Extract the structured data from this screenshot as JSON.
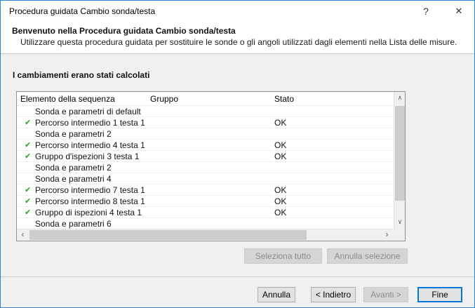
{
  "window": {
    "title": "Procedura guidata Cambio sonda/testa"
  },
  "icons": {
    "help_icon": "?",
    "close_icon": "✕",
    "scroll_up_icon": "∧",
    "scroll_down_icon": "∨",
    "scroll_left_icon": "‹",
    "scroll_right_icon": "›"
  },
  "header": {
    "title": "Benvenuto nella Procedura guidata Cambio sonda/testa",
    "subtitle": "Utilizzare questa procedura guidata per sostituire le sonde o gli angoli utilizzati dagli elementi nella Lista delle misure."
  },
  "content": {
    "section_label": "I cambiamenti erano stati calcolati",
    "table": {
      "columns": [
        "Elemento della sequenza",
        "Gruppo",
        "Stato"
      ],
      "rows": [
        {
          "check": "",
          "name": "Sonda e parametri di default",
          "group": "",
          "status": ""
        },
        {
          "check": "✔",
          "name": "Percorso intermedio 1 testa 1",
          "group": "",
          "status": "OK"
        },
        {
          "check": "",
          "name": "Sonda e parametri 2",
          "group": "",
          "status": ""
        },
        {
          "check": "✔",
          "name": "Percorso intermedio 4 testa 1",
          "group": "",
          "status": "OK"
        },
        {
          "check": "✔",
          "name": "Gruppo d'ispezioni 3 testa 1",
          "group": "",
          "status": "OK"
        },
        {
          "check": "",
          "name": "Sonda e parametri 2",
          "group": "",
          "status": ""
        },
        {
          "check": "",
          "name": "Sonda e parametri 4",
          "group": "",
          "status": ""
        },
        {
          "check": "✔",
          "name": "Percorso intermedio 7 testa 1",
          "group": "",
          "status": "OK"
        },
        {
          "check": "✔",
          "name": "Percorso intermedio 8 testa 1",
          "group": "",
          "status": "OK"
        },
        {
          "check": "✔",
          "name": "Gruppo di ispezioni 4 testa 1",
          "group": "",
          "status": "OK"
        },
        {
          "check": "",
          "name": "Sonda e parametri 6",
          "group": "",
          "status": ""
        }
      ]
    },
    "buttons": {
      "select_all": "Seleziona tutto",
      "clear_selection": "Annulla selezione"
    }
  },
  "footer": {
    "cancel": "Annulla",
    "back": "< Indietro",
    "next": "Avanti >",
    "finish": "Fine"
  },
  "colors": {
    "accent_border": "#2b83d9",
    "default_button_border": "#0078d7",
    "check_green": "#2ba32b",
    "disabled_text": "#8c8c8c"
  }
}
